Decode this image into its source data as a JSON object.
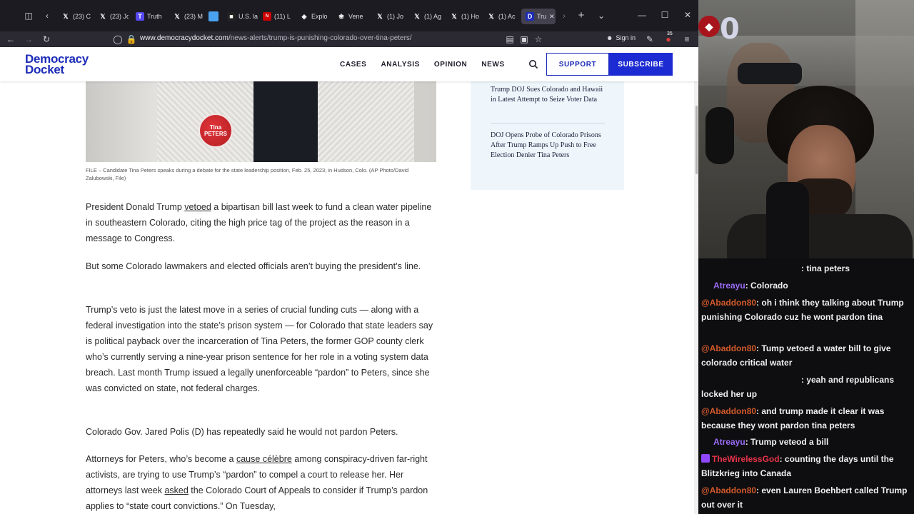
{
  "browser": {
    "tabs": [
      {
        "label": "(23) C",
        "icon": "x-icon"
      },
      {
        "label": "(23) Jo",
        "icon": "x-icon"
      },
      {
        "label": "Truth",
        "icon": "truth-social-icon"
      },
      {
        "label": "(23) M",
        "icon": "x-icon"
      },
      {
        "label": "",
        "icon": "blue-square-icon"
      },
      {
        "label": "U.S. la",
        "icon": "news-icon"
      },
      {
        "label": "(11) L",
        "icon": "cnn-icon"
      },
      {
        "label": "Explo",
        "icon": "globe-icon"
      },
      {
        "label": "Vene",
        "icon": "chatgpt-icon"
      },
      {
        "label": "(1) Jo",
        "icon": "x-icon"
      },
      {
        "label": "(1) Ag",
        "icon": "x-icon"
      },
      {
        "label": "(1) Ho",
        "icon": "x-icon"
      },
      {
        "label": "(1) Ac",
        "icon": "x-icon"
      },
      {
        "label": "Tru",
        "icon": "democracy-docket-icon",
        "active": true
      }
    ],
    "url_domain": "www.democracydocket.com",
    "url_path": "/news-alerts/trump-is-punishing-colorado-over-tina-peters/",
    "sign_in": "Sign in",
    "ext_badge": "35"
  },
  "site": {
    "logo_line1": "Democracy",
    "logo_line2": "Docket",
    "nav": [
      "CASES",
      "ANALYSIS",
      "OPINION",
      "NEWS"
    ],
    "support": "SUPPORT",
    "subscribe": "SUBSCRIBE",
    "accent": "#1c2bb8"
  },
  "article": {
    "pin_text": "Tina PETERS",
    "caption": "FILE – Candidate Tina Peters speaks during a debate for the state leadership position, Feb. 25, 2023, in Hudson, Colo. (AP Photo/David Zalubowski, File)",
    "p1_a": "President Donald Trump ",
    "p1_link": "vetoed",
    "p1_b": " a bipartisan bill last week to fund a clean water pipeline in southeastern Colorado, citing the high price tag of the project as the reason in a message to Congress.",
    "p2": "But some Colorado lawmakers and elected officials aren’t buying the president’s line.",
    "p3": "Trump’s veto is just the latest move in a series of crucial funding cuts — along with a federal investigation into the state’s prison system — for Colorado that state leaders say is political payback over the incarceration of Tina Peters, the former GOP county clerk who’s currently serving a nine-year prison sentence for her role in a voting system data breach. Last month Trump issued a legally unenforceable “pardon” to Peters, since she was convicted on state, not federal charges.",
    "p4": "Colorado Gov. Jared Polis (D) has repeatedly said he would not pardon Peters.",
    "p5_a": "Attorneys for Peters, who’s become a ",
    "p5_link1": "cause célèbre",
    "p5_b": " among conspiracy-driven far-right activists, are trying to use Trump’s “pardon” to compel a court to release her. Her attorneys last week ",
    "p5_link2": "asked",
    "p5_c": " the Colorado Court of Appeals to consider if Trump’s pardon applies to “state court convictions.” On Tuesday,"
  },
  "related": [
    "Trump DOJ Sues Colorado and Hawaii in Latest Attempt to Seize Voter Data",
    "DOJ Opens Probe of Colorado Prisons After Trump Ramps Up Push to Free Election Denier Tina Peters"
  ],
  "stream": {
    "overlay_number": "0"
  },
  "chat": [
    {
      "user": "",
      "text": ": tina peters",
      "color": "#efeff1"
    },
    {
      "user": "Atreayu",
      "text": ": Colorado",
      "color": "#9b6cf7"
    },
    {
      "user": "@Abaddon80",
      "text": ": oh i think they talking about Trump punishing Colorado cuz he wont pardon tina",
      "color": "#d2592b"
    },
    {
      "user": "@Abaddon80",
      "text": ": Tump vetoed a water bill to give colorado critical water",
      "color": "#d2592b"
    },
    {
      "user": "",
      "text": ": yeah and republicans locked her up",
      "color": "#efeff1"
    },
    {
      "user": "@Abaddon80",
      "text": ": and trump made it clear it was because they wont pardon tina peters",
      "color": "#d2592b"
    },
    {
      "user": "Atreayu",
      "text": ": Trump veteod a bill",
      "color": "#9b6cf7"
    },
    {
      "user": "TheWirelessGod",
      "text": ": counting the days until the Blitzkrieg into Canada",
      "color": "#e8334a",
      "badge": true
    },
    {
      "user": "@Abaddon80",
      "text": ": even Lauren Boehbert called Trump out over it",
      "color": "#d2592b"
    }
  ]
}
